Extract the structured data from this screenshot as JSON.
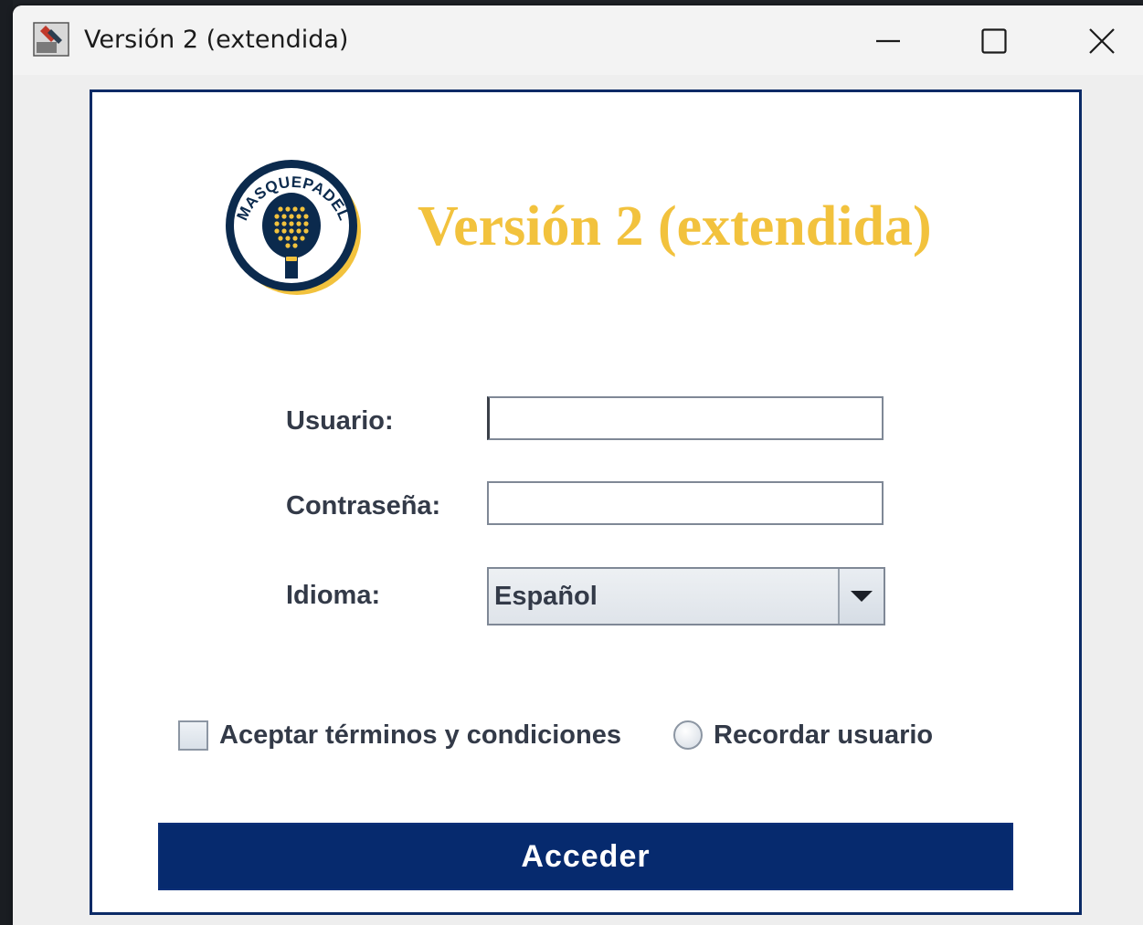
{
  "window": {
    "title": "Versión 2 (extendida)",
    "icon": "java-app-icon",
    "controls": {
      "minimize_icon": "minimize-icon",
      "maximize_icon": "maximize-icon",
      "close_icon": "close-icon"
    }
  },
  "header": {
    "logo_icon": "masquepadel-logo",
    "logo_text": "MASQUEPADEL",
    "title": "Versión 2 (extendida)",
    "title_color": "#f2c23d"
  },
  "form": {
    "user_label": "Usuario:",
    "user_value": "",
    "password_label": "Contraseña:",
    "password_value": "",
    "language_label": "Idioma:",
    "language_selected": "Español",
    "terms_label": "Aceptar términos y condiciones",
    "terms_checked": false,
    "remember_label": "Recordar usuario",
    "remember_selected": false,
    "submit_label": "Acceder"
  },
  "colors": {
    "brand_navy": "#062a6e",
    "brand_gold": "#f2c23d",
    "label_text": "#333a48"
  }
}
